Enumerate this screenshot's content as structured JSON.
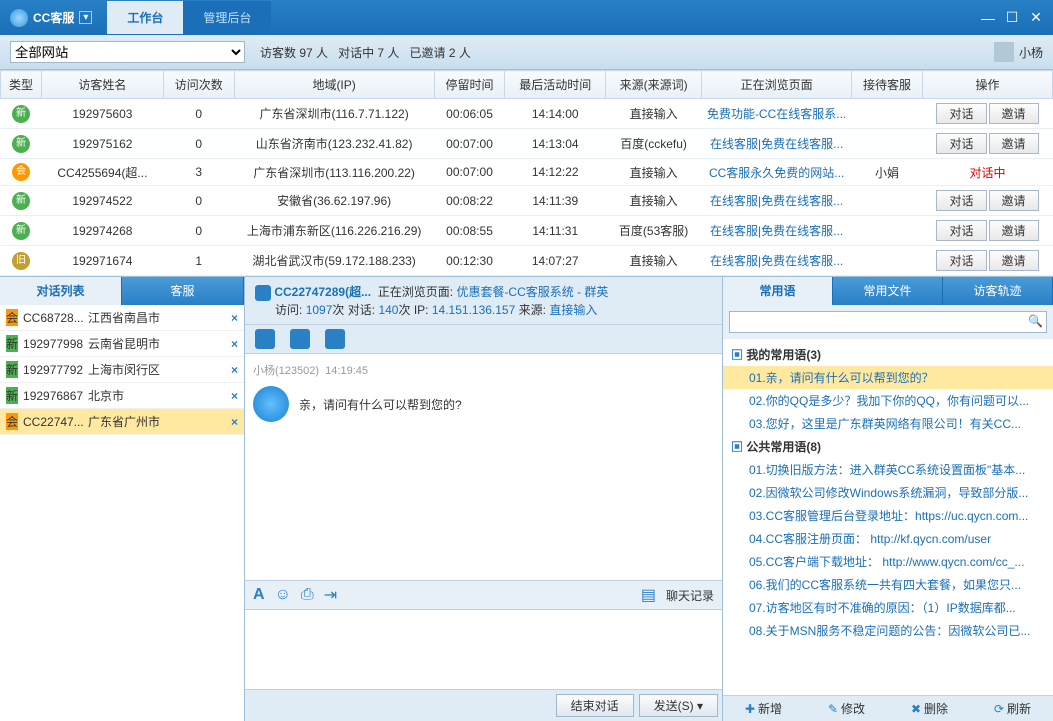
{
  "app": {
    "title": "CC客服"
  },
  "main_tabs": {
    "workbench": "工作台",
    "admin": "管理后台"
  },
  "toolbar": {
    "site_select": "全部网站",
    "visitors_label": "访客数",
    "visitors_count": "97 人",
    "chatting_label": "对话中",
    "chatting_count": "7 人",
    "invited_label": "已邀请",
    "invited_count": "2 人",
    "username": "小杨"
  },
  "grid": {
    "headers": {
      "type": "类型",
      "name": "访客姓名",
      "visits": "访问次数",
      "region": "地域(IP)",
      "stay": "停留时间",
      "last": "最后活动时间",
      "source": "来源(来源词)",
      "page": "正在浏览页面",
      "agent": "接待客服",
      "op": "操作"
    },
    "btn_chat": "对话",
    "btn_invite": "邀请",
    "dialoging": "对话中",
    "rows": [
      {
        "badge": "新",
        "bc": "badge-new",
        "name": "192975603",
        "visits": "0",
        "region": "广东省深圳市(116.7.71.122)",
        "stay": "00:06:05",
        "last": "14:14:00",
        "source": "直接输入",
        "page": "免费功能-CC在线客服系...",
        "agent": "",
        "op": "btns"
      },
      {
        "badge": "新",
        "bc": "badge-new",
        "name": "192975162",
        "visits": "0",
        "region": "山东省济南市(123.232.41.82)",
        "stay": "00:07:00",
        "last": "14:13:04",
        "source": "百度(cckefu)",
        "page": "在线客服|免费在线客服...",
        "agent": "",
        "op": "btns"
      },
      {
        "badge": "会",
        "bc": "badge-hui",
        "name": "CC4255694(超...",
        "visits": "3",
        "region": "广东省深圳市(113.116.200.22)",
        "stay": "00:07:00",
        "last": "14:12:22",
        "source": "直接输入",
        "page": "CC客服永久免费的网站...",
        "agent": "小娟",
        "op": "dialoging"
      },
      {
        "badge": "新",
        "bc": "badge-new",
        "name": "192974522",
        "visits": "0",
        "region": "安徽省(36.62.197.96)",
        "stay": "00:08:22",
        "last": "14:11:39",
        "source": "直接输入",
        "page": "在线客服|免费在线客服...",
        "agent": "",
        "op": "btns"
      },
      {
        "badge": "新",
        "bc": "badge-new",
        "name": "192974268",
        "visits": "0",
        "region": "上海市浦东新区(116.226.216.29)",
        "stay": "00:08:55",
        "last": "14:11:31",
        "source": "百度(53客服)",
        "page": "在线客服|免费在线客服...",
        "agent": "",
        "op": "btns"
      },
      {
        "badge": "旧",
        "bc": "badge-jiu",
        "name": "192971674",
        "visits": "1",
        "region": "湖北省武汉市(59.172.188.233)",
        "stay": "00:12:30",
        "last": "14:07:27",
        "source": "直接输入",
        "page": "在线客服|免费在线客服...",
        "agent": "",
        "op": "btns"
      }
    ]
  },
  "left_tabs": {
    "conv": "对话列表",
    "agent": "客服"
  },
  "conversations": [
    {
      "badge": "会",
      "bc": "badge-hui",
      "id": "CC68728...",
      "loc": "江西省南昌市",
      "sel": false
    },
    {
      "badge": "新",
      "bc": "badge-new",
      "id": "192977998",
      "loc": "云南省昆明市",
      "sel": false
    },
    {
      "badge": "新",
      "bc": "badge-new",
      "id": "192977792",
      "loc": "上海市闵行区",
      "sel": false
    },
    {
      "badge": "新",
      "bc": "badge-new",
      "id": "192976867",
      "loc": "北京市",
      "sel": false
    },
    {
      "badge": "会",
      "bc": "badge-hui",
      "id": "CC22747...",
      "loc": "广东省广州市",
      "sel": true
    }
  ],
  "chat": {
    "visitor_name": "CC22747289(超...",
    "browsing_label": "正在浏览页面:",
    "browsing_page": "优惠套餐-CC客服系统 - 群英",
    "visit_label": "访问:",
    "visit_count": "1097",
    "visit_unit": "次",
    "chat_label": "对话:",
    "chat_count": "140",
    "chat_unit": "次",
    "ip_label": "IP:",
    "ip": "14.151.136.157",
    "source_label": "来源:",
    "source": "直接输入",
    "sender": "小杨(123502)",
    "time": "14:19:45",
    "message": "亲，请问有什么可以帮到您的?",
    "history": "聊天记录",
    "end": "结束对话",
    "send": "发送(S)"
  },
  "right_tabs": {
    "phrases": "常用语",
    "files": "常用文件",
    "track": "访客轨迹"
  },
  "phrases": {
    "my_group": "我的常用语(3)",
    "my": [
      "01.亲，请问有什么可以帮到您的？",
      "02.你的QQ是多少？我加下你的QQ，你有问题可以...",
      "03.您好，这里是广东群英网络有限公司！有关CC..."
    ],
    "pub_group": "公共常用语(8)",
    "pub": [
      "01.切换旧版方法：进入群英CC系统设置面板\"基本...",
      "02.因微软公司修改Windows系统漏洞，导致部分版...",
      "03.CC客服管理后台登录地址：https://uc.qycn.com...",
      "04.CC客服注册页面： http://kf.qycn.com/user",
      "05.CC客户端下载地址： http://www.qycn.com/cc_...",
      "06.我们的CC客服系统一共有四大套餐，如果您只...",
      "07.访客地区有时不准确的原因：（1）IP数据库都...",
      "08.关于MSN服务不稳定问题的公告：因微软公司已..."
    ]
  },
  "right_footer": {
    "add": "新增",
    "edit": "修改",
    "del": "删除",
    "refresh": "刷新"
  }
}
